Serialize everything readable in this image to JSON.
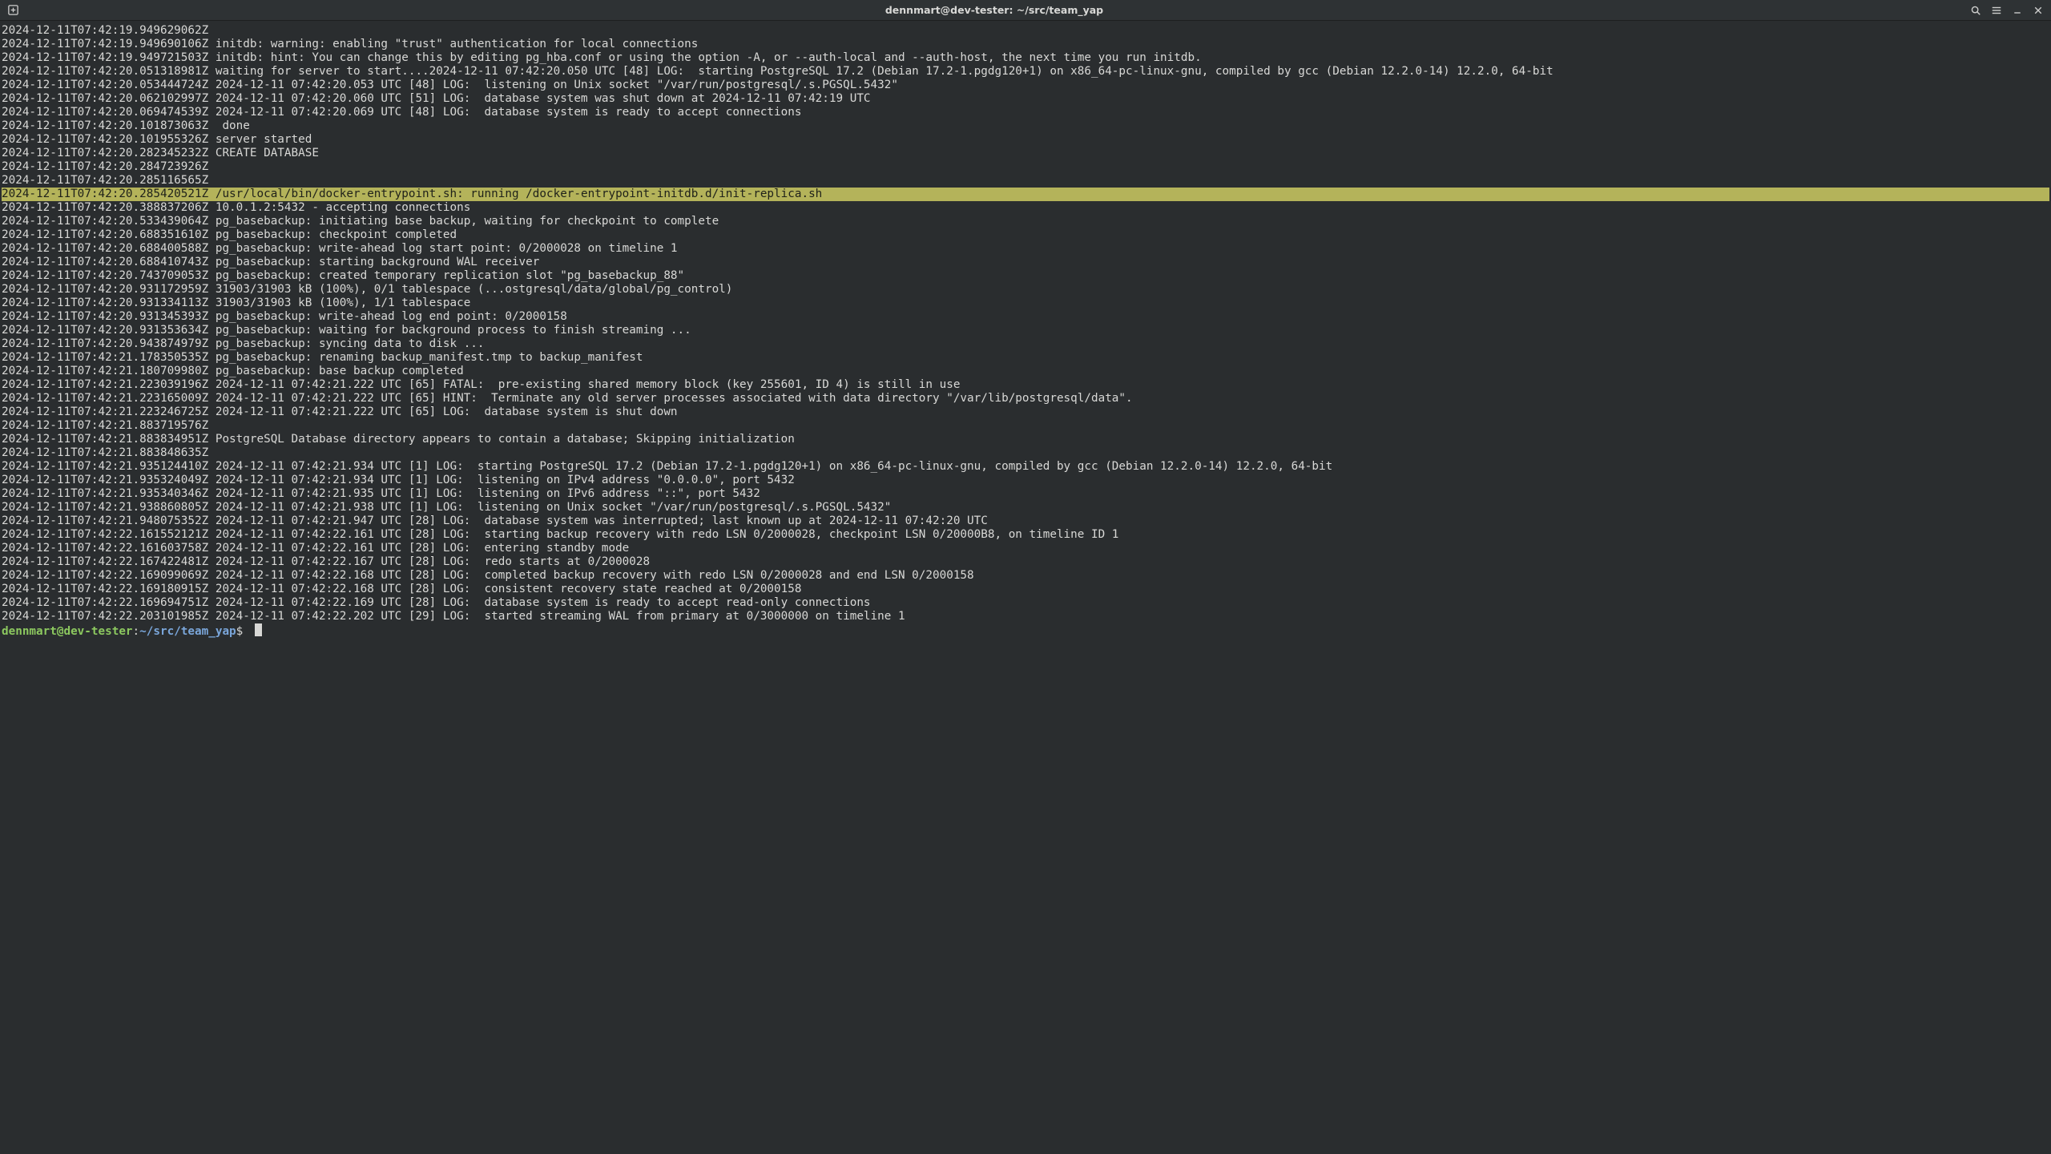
{
  "colors": {
    "bg": "#2a2d2f",
    "fg": "#d8d8d6",
    "titlebar_bg": "#2e3234",
    "highlight_bg": "#b4b35a",
    "highlight_fg": "#20221a",
    "prompt_user": "#8cc85f",
    "prompt_path": "#7aa6da"
  },
  "titlebar": {
    "title": "dennmart@dev-tester: ~/src/team_yap",
    "buttons_left": [
      {
        "name": "new-tab-button",
        "icon": "plus-box"
      }
    ],
    "buttons_right": [
      {
        "name": "search-button",
        "icon": "search"
      },
      {
        "name": "menu-button",
        "icon": "hamburger"
      },
      {
        "name": "minimize-button",
        "icon": "minimize"
      },
      {
        "name": "close-button",
        "icon": "close"
      }
    ]
  },
  "prompt": {
    "user_host": "dennmart@dev-tester",
    "path": "~/src/team_yap",
    "symbol": "$"
  },
  "lines": [
    {
      "text": "2024-12-11T07:42:19.949629062Z "
    },
    {
      "text": "2024-12-11T07:42:19.949690106Z initdb: warning: enabling \"trust\" authentication for local connections"
    },
    {
      "text": "2024-12-11T07:42:19.949721503Z initdb: hint: You can change this by editing pg_hba.conf or using the option -A, or --auth-local and --auth-host, the next time you run initdb."
    },
    {
      "text": "2024-12-11T07:42:20.051318981Z waiting for server to start....2024-12-11 07:42:20.050 UTC [48] LOG:  starting PostgreSQL 17.2 (Debian 17.2-1.pgdg120+1) on x86_64-pc-linux-gnu, compiled by gcc (Debian 12.2.0-14) 12.2.0, 64-bit"
    },
    {
      "text": "2024-12-11T07:42:20.053444724Z 2024-12-11 07:42:20.053 UTC [48] LOG:  listening on Unix socket \"/var/run/postgresql/.s.PGSQL.5432\""
    },
    {
      "text": "2024-12-11T07:42:20.062102997Z 2024-12-11 07:42:20.060 UTC [51] LOG:  database system was shut down at 2024-12-11 07:42:19 UTC"
    },
    {
      "text": "2024-12-11T07:42:20.069474539Z 2024-12-11 07:42:20.069 UTC [48] LOG:  database system is ready to accept connections"
    },
    {
      "text": "2024-12-11T07:42:20.101873063Z  done"
    },
    {
      "text": "2024-12-11T07:42:20.101955326Z server started"
    },
    {
      "text": "2024-12-11T07:42:20.282345232Z CREATE DATABASE"
    },
    {
      "text": "2024-12-11T07:42:20.284723926Z "
    },
    {
      "text": "2024-12-11T07:42:20.285116565Z "
    },
    {
      "text": "2024-12-11T07:42:20.285420521Z /usr/local/bin/docker-entrypoint.sh: running /docker-entrypoint-initdb.d/init-replica.sh ",
      "highlight": true
    },
    {
      "text": "2024-12-11T07:42:20.388837206Z 10.0.1.2:5432 - accepting connections"
    },
    {
      "text": "2024-12-11T07:42:20.533439064Z pg_basebackup: initiating base backup, waiting for checkpoint to complete"
    },
    {
      "text": "2024-12-11T07:42:20.688351610Z pg_basebackup: checkpoint completed"
    },
    {
      "text": "2024-12-11T07:42:20.688400588Z pg_basebackup: write-ahead log start point: 0/2000028 on timeline 1"
    },
    {
      "text": "2024-12-11T07:42:20.688410743Z pg_basebackup: starting background WAL receiver"
    },
    {
      "text": "2024-12-11T07:42:20.743709053Z pg_basebackup: created temporary replication slot \"pg_basebackup_88\""
    },
    {
      "text": "2024-12-11T07:42:20.931172959Z 31903/31903 kB (100%), 0/1 tablespace (...ostgresql/data/global/pg_control)"
    },
    {
      "text": "2024-12-11T07:42:20.931334113Z 31903/31903 kB (100%), 1/1 tablespace"
    },
    {
      "text": "2024-12-11T07:42:20.931345393Z pg_basebackup: write-ahead log end point: 0/2000158"
    },
    {
      "text": "2024-12-11T07:42:20.931353634Z pg_basebackup: waiting for background process to finish streaming ..."
    },
    {
      "text": "2024-12-11T07:42:20.943874979Z pg_basebackup: syncing data to disk ..."
    },
    {
      "text": "2024-12-11T07:42:21.178350535Z pg_basebackup: renaming backup_manifest.tmp to backup_manifest"
    },
    {
      "text": "2024-12-11T07:42:21.180709980Z pg_basebackup: base backup completed"
    },
    {
      "text": "2024-12-11T07:42:21.223039196Z 2024-12-11 07:42:21.222 UTC [65] FATAL:  pre-existing shared memory block (key 255601, ID 4) is still in use"
    },
    {
      "text": "2024-12-11T07:42:21.223165009Z 2024-12-11 07:42:21.222 UTC [65] HINT:  Terminate any old server processes associated with data directory \"/var/lib/postgresql/data\"."
    },
    {
      "text": "2024-12-11T07:42:21.223246725Z 2024-12-11 07:42:21.222 UTC [65] LOG:  database system is shut down"
    },
    {
      "text": "2024-12-11T07:42:21.883719576Z "
    },
    {
      "text": "2024-12-11T07:42:21.883834951Z PostgreSQL Database directory appears to contain a database; Skipping initialization"
    },
    {
      "text": "2024-12-11T07:42:21.883848635Z "
    },
    {
      "text": "2024-12-11T07:42:21.935124410Z 2024-12-11 07:42:21.934 UTC [1] LOG:  starting PostgreSQL 17.2 (Debian 17.2-1.pgdg120+1) on x86_64-pc-linux-gnu, compiled by gcc (Debian 12.2.0-14) 12.2.0, 64-bit"
    },
    {
      "text": "2024-12-11T07:42:21.935324049Z 2024-12-11 07:42:21.934 UTC [1] LOG:  listening on IPv4 address \"0.0.0.0\", port 5432"
    },
    {
      "text": "2024-12-11T07:42:21.935340346Z 2024-12-11 07:42:21.935 UTC [1] LOG:  listening on IPv6 address \"::\", port 5432"
    },
    {
      "text": "2024-12-11T07:42:21.938860805Z 2024-12-11 07:42:21.938 UTC [1] LOG:  listening on Unix socket \"/var/run/postgresql/.s.PGSQL.5432\""
    },
    {
      "text": "2024-12-11T07:42:21.948075352Z 2024-12-11 07:42:21.947 UTC [28] LOG:  database system was interrupted; last known up at 2024-12-11 07:42:20 UTC"
    },
    {
      "text": "2024-12-11T07:42:22.161552121Z 2024-12-11 07:42:22.161 UTC [28] LOG:  starting backup recovery with redo LSN 0/2000028, checkpoint LSN 0/20000B8, on timeline ID 1"
    },
    {
      "text": "2024-12-11T07:42:22.161603758Z 2024-12-11 07:42:22.161 UTC [28] LOG:  entering standby mode"
    },
    {
      "text": "2024-12-11T07:42:22.167422481Z 2024-12-11 07:42:22.167 UTC [28] LOG:  redo starts at 0/2000028"
    },
    {
      "text": "2024-12-11T07:42:22.169099069Z 2024-12-11 07:42:22.168 UTC [28] LOG:  completed backup recovery with redo LSN 0/2000028 and end LSN 0/2000158"
    },
    {
      "text": "2024-12-11T07:42:22.169180915Z 2024-12-11 07:42:22.168 UTC [28] LOG:  consistent recovery state reached at 0/2000158"
    },
    {
      "text": "2024-12-11T07:42:22.169694751Z 2024-12-11 07:42:22.169 UTC [28] LOG:  database system is ready to accept read-only connections"
    },
    {
      "text": "2024-12-11T07:42:22.203101985Z 2024-12-11 07:42:22.202 UTC [29] LOG:  started streaming WAL from primary at 0/3000000 on timeline 1"
    }
  ]
}
